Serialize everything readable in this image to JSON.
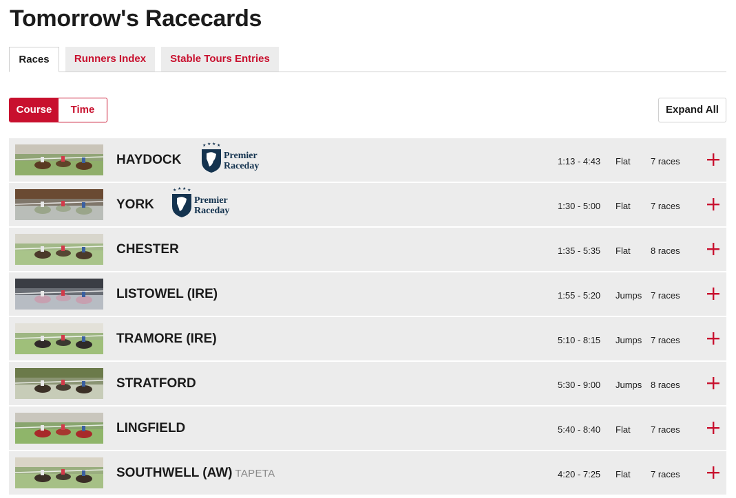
{
  "page": {
    "title": "Tomorrow's Racecards"
  },
  "tabs": [
    {
      "label": "Races",
      "active": true
    },
    {
      "label": "Runners Index",
      "active": false
    },
    {
      "label": "Stable Tours Entries",
      "active": false
    }
  ],
  "sort_toggle": {
    "course_label": "Course",
    "time_label": "Time",
    "selected": "Course"
  },
  "expand_all_label": "Expand All",
  "colors": {
    "accent": "#c8102e",
    "row_bg": "#ececec",
    "premier_navy": "#14334f"
  },
  "premier_logo": {
    "line1": "Premier",
    "line2": "Raceday"
  },
  "meetings": [
    {
      "course": "HAYDOCK",
      "surface": "",
      "premier": true,
      "times": "1:13 - 4:43",
      "type": "Flat",
      "races": "7 races"
    },
    {
      "course": "YORK",
      "surface": "",
      "premier": true,
      "times": "1:30 - 5:00",
      "type": "Flat",
      "races": "7 races"
    },
    {
      "course": "CHESTER",
      "surface": "",
      "premier": false,
      "times": "1:35 - 5:35",
      "type": "Flat",
      "races": "8 races"
    },
    {
      "course": "LISTOWEL (IRE)",
      "surface": "",
      "premier": false,
      "times": "1:55 - 5:20",
      "type": "Jumps",
      "races": "7 races"
    },
    {
      "course": "TRAMORE (IRE)",
      "surface": "",
      "premier": false,
      "times": "5:10 - 8:15",
      "type": "Jumps",
      "races": "7 races"
    },
    {
      "course": "STRATFORD",
      "surface": "",
      "premier": false,
      "times": "5:30 - 9:00",
      "type": "Jumps",
      "races": "8 races"
    },
    {
      "course": "LINGFIELD",
      "surface": "",
      "premier": false,
      "times": "5:40 - 8:40",
      "type": "Flat",
      "races": "7 races"
    },
    {
      "course": "SOUTHWELL (AW)",
      "surface": "TAPETA",
      "premier": false,
      "times": "4:20 - 7:25",
      "type": "Flat",
      "races": "7 races"
    }
  ]
}
